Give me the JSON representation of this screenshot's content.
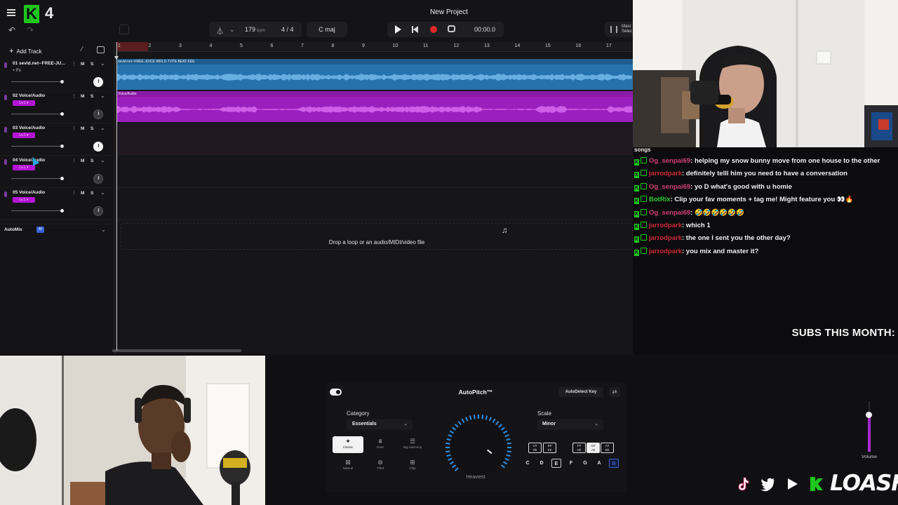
{
  "app": {
    "logo_number": "4",
    "project_title": "New Project"
  },
  "toolbar": {
    "bpm_value": "179",
    "bpm_unit": "bpm",
    "time_signature": "4 / 4",
    "key": "C maj",
    "time_position": "00:00.0",
    "master_label": "Mast\nSelec"
  },
  "sidebar": {
    "add_track": "Add Track",
    "automix_label": "AutoMix",
    "automix_badge": "AI"
  },
  "ruler": [
    "1",
    "2",
    "3",
    "4",
    "5",
    "6",
    "7",
    "8",
    "9",
    "10",
    "11",
    "12",
    "13",
    "14",
    "15",
    "16",
    "17"
  ],
  "tracks": [
    {
      "number_name": "01 sevid.net--FREE-JU...",
      "sub": "+ Fx",
      "badge": "",
      "clip": "sevid.net--FREE-JUICE-WRLD-TYPE-BEAT-KEE",
      "active": true
    },
    {
      "number_name": "02 Voice/Audio",
      "sub": "",
      "badge": "Lv.1 ▾",
      "clip": "Voice/Audio",
      "active": false
    },
    {
      "number_name": "03 Voice/Audio",
      "sub": "",
      "badge": "Lv.1 ▾",
      "clip": "",
      "active": true
    },
    {
      "number_name": "04 Voice/Audio",
      "sub": "",
      "badge": "Lv.1 ▾",
      "clip": "",
      "active": false
    },
    {
      "number_name": "05 Voice/Audio",
      "sub": "",
      "badge": "Lv.1 ▾",
      "clip": "",
      "active": false
    }
  ],
  "dropzone": {
    "text": "Drop a loop or an audio/MIDI/video file"
  },
  "chat": {
    "header": "songs",
    "messages": [
      {
        "user": "Og_senpai69",
        "text": ": helping my snow bunny move from one house to the other",
        "user_color": "pink"
      },
      {
        "user": "jarrodpark",
        "text": ": definitely telll him you need to have a conversation",
        "user_color": "red"
      },
      {
        "user": "Og_senpai69",
        "text": ": yo D what's good with u homie",
        "user_color": "pink"
      },
      {
        "user": "BotRix",
        "text": ": Clip your fav moments + tag me! Might feature you 👀🔥",
        "user_color": "bot"
      },
      {
        "user": "Og_senpai69",
        "text": ": 🤣🤣🤣🤣🤣🤣",
        "user_color": "pink"
      },
      {
        "user": "jarrodpark",
        "text": ": which 1",
        "user_color": "red"
      },
      {
        "user": "jarrodpark",
        "text": ": the one I sent you the other day?",
        "user_color": "red"
      },
      {
        "user": "jarrodpark",
        "text": ": you mix and master it?",
        "user_color": "red"
      }
    ]
  },
  "subs_label": "SUBS THIS MONTH:",
  "autopitch": {
    "title": "AutoPitch™",
    "detect_key": "AutoDetect Key",
    "category_label": "Category",
    "category_value": "Essentials",
    "scale_label": "Scale",
    "scale_value": "Minor",
    "dial_label": "Heaviest",
    "presets": [
      "Classic",
      "Duet",
      "Big Harmony",
      "Natural",
      "Third",
      "Chip"
    ],
    "chords": [
      "C#\nDb",
      "D#\nEb",
      "F#\nGb",
      "G#\nAb",
      "A#\nBb"
    ],
    "notes": [
      "C",
      "D",
      "E",
      "F",
      "G",
      "A",
      "B"
    ],
    "selected_note": "E",
    "highlighted_note": "B"
  },
  "volume": {
    "label": "Volume",
    "level": 0.72
  },
  "brand": "LOASH"
}
